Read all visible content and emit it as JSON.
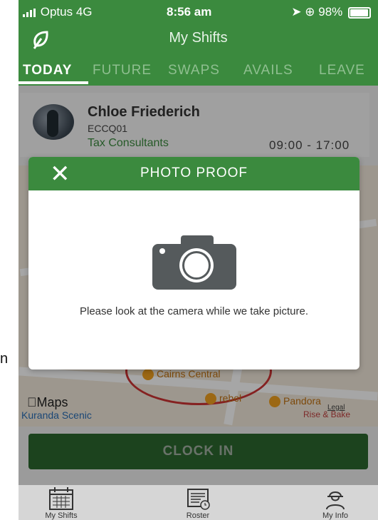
{
  "status_bar": {
    "carrier": "Optus",
    "network": "4G",
    "time": "8:56 am",
    "battery": "98%"
  },
  "header": {
    "title": "My Shifts"
  },
  "tabs": [
    {
      "label": "TODAY",
      "active": true
    },
    {
      "label": "FUTURE"
    },
    {
      "label": "SWAPS"
    },
    {
      "label": "AVAILS"
    },
    {
      "label": "LEAVE"
    }
  ],
  "shift": {
    "name": "Chloe Friederich",
    "code": "ECCQ01",
    "department": "Tax Consultants",
    "time": "09:00 - 17:00"
  },
  "map": {
    "logo": "Maps",
    "label_kuranda": "Kuranda Scenic",
    "label_cairns": "Cairns Central",
    "label_rebel": "rebel",
    "label_pandora": "Pandora",
    "label_rise": "Rise & Bake",
    "label_legal": "Legal"
  },
  "clock_in": {
    "label": "CLOCK IN"
  },
  "modal": {
    "title": "PHOTO PROOF",
    "close": "✕",
    "message": "Please look at the camera while we take picture."
  },
  "nav": [
    {
      "label": "My Shifts",
      "icon": "calendar-icon"
    },
    {
      "label": "Roster",
      "icon": "roster-icon"
    },
    {
      "label": "My Info",
      "icon": "user-icon"
    }
  ],
  "colors": {
    "primary": "#3b8a3e",
    "tab_inactive": "#8fbf90",
    "camera": "#555a5c"
  }
}
